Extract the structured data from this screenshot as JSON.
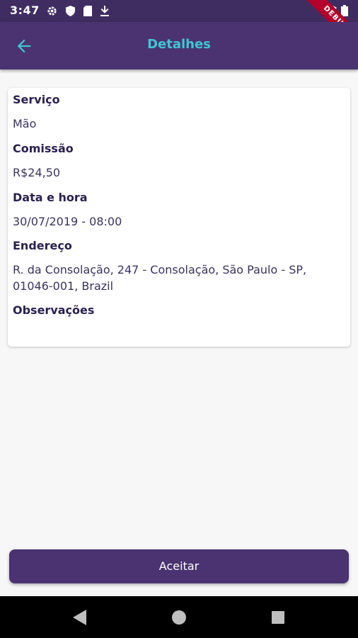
{
  "status_bar": {
    "time": "3:47",
    "left_icons": [
      "gear-icon",
      "shield-icon",
      "sd-card-icon",
      "download-icon"
    ],
    "right_icons": [
      "wifi-icon",
      "battery-icon"
    ],
    "debug_label": "DEBUG"
  },
  "app_bar": {
    "back_icon": "arrow-left-icon",
    "title": "Detalhes",
    "title_color": "#3fc7d3",
    "background": "#4a3370"
  },
  "details": {
    "servico_label": "Serviço",
    "servico_value": "Mão",
    "comissao_label": "Comissão",
    "comissao_value": "R$24,50",
    "data_label": "Data e hora",
    "data_value": "30/07/2019 - 08:00",
    "endereco_label": "Endereço",
    "endereco_value": "R. da Consolação, 247 - Consolação, São Paulo - SP, 01046-001, Brazil",
    "observacoes_label": "Observações",
    "observacoes_value": ""
  },
  "actions": {
    "accept_label": "Aceitar"
  },
  "nav_bar": {
    "icons": [
      "back-triangle-icon",
      "home-circle-icon",
      "recents-square-icon"
    ]
  }
}
